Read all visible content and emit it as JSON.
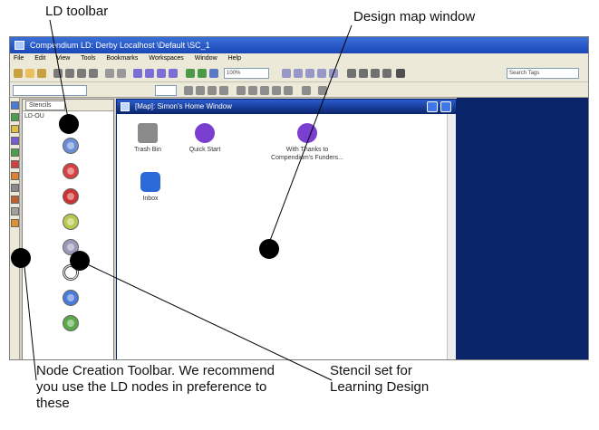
{
  "callouts": {
    "ld_toolbar": "LD toolbar",
    "design_map_window": "Design map window",
    "node_creation": "Node Creation Toolbar. We recommend you use the LD nodes in preference to these",
    "stencil_set": "Stencil set for Learning Design"
  },
  "app": {
    "title": "Compendium LD: Derby Localhost \\Default \\SC_1",
    "menu": [
      "File",
      "Edit",
      "View",
      "Tools",
      "Bookmarks",
      "Workspaces",
      "Window",
      "Help"
    ]
  },
  "toolbar": {
    "zoom_value": "100%",
    "search_placeholder": "Search Tags"
  },
  "stencil": {
    "tab_label": "Stencils",
    "set_label": "LD-OU",
    "icon_colors": [
      "#6b8ed6",
      "#d64040",
      "#cc3333",
      "#b8c850",
      "#9a9ab8",
      "#444444",
      "#4b7bd8",
      "#5aa84a"
    ]
  },
  "map_window": {
    "title": "[Map]: Simon's Home Window",
    "nodes": [
      {
        "label": "Trash Bin",
        "icon": "trash-icon"
      },
      {
        "label": "Quick Start",
        "icon": "map-node-icon"
      },
      {
        "label": "With Thanks to Compendium's Funders...",
        "label_display": "With Thanks to\nCompendium's Funders...",
        "icon": "map-node-icon"
      },
      {
        "label": "Inbox",
        "icon": "inbox-icon"
      }
    ]
  },
  "colors": {
    "title_blue": "#1b48b8",
    "desktop_blue": "#0a246a",
    "chrome": "#ece9d8"
  }
}
